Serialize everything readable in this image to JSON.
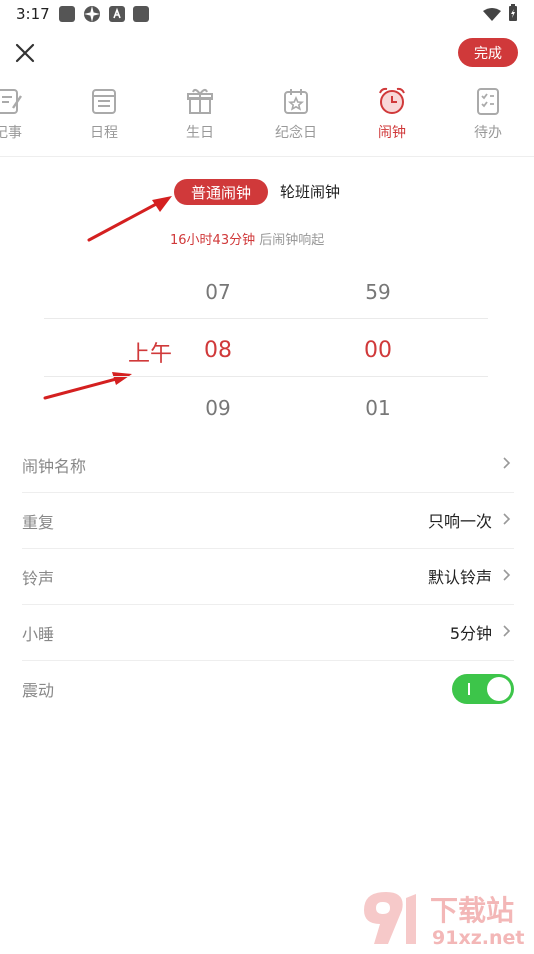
{
  "status_bar": {
    "time": "3:17"
  },
  "header": {
    "done_label": "完成"
  },
  "tabs": [
    {
      "label": "记事",
      "icon": "note-icon",
      "active": false
    },
    {
      "label": "日程",
      "icon": "schedule-icon",
      "active": false
    },
    {
      "label": "生日",
      "icon": "gift-icon",
      "active": false
    },
    {
      "label": "纪念日",
      "icon": "calendar-star-icon",
      "active": false
    },
    {
      "label": "闹钟",
      "icon": "alarm-clock-icon",
      "active": true
    },
    {
      "label": "待办",
      "icon": "checklist-icon",
      "active": false
    }
  ],
  "alarm_type": {
    "normal": "普通闹钟",
    "shift": "轮班闹钟",
    "selected": "normal"
  },
  "countdown": {
    "highlight": "16小时43分钟",
    "rest": "后闹钟响起"
  },
  "picker": {
    "ampm": "上午",
    "hours": [
      "07",
      "08",
      "09"
    ],
    "minutes": [
      "59",
      "00",
      "01"
    ]
  },
  "settings": {
    "name": {
      "label": "闹钟名称",
      "value": ""
    },
    "repeat": {
      "label": "重复",
      "value": "只响一次"
    },
    "ringtone": {
      "label": "铃声",
      "value": "默认铃声"
    },
    "snooze": {
      "label": "小睡",
      "value": "5分钟"
    },
    "vibrate": {
      "label": "震动",
      "on": true
    }
  },
  "watermark": {
    "text": "下载站",
    "domain": "91xz.net"
  },
  "colors": {
    "accent": "#d0393a",
    "toggle_on": "#3dc54a"
  }
}
